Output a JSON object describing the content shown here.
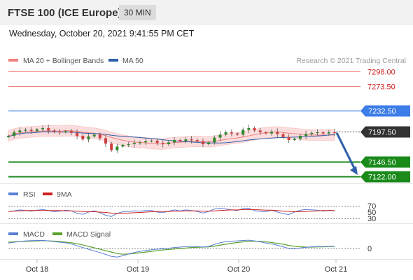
{
  "header": {
    "title": "FTSE 100 (ICE Europe)",
    "interval": "30 MIN"
  },
  "datetime": "Wednesday, October 20, 2021 9:41:55 PM CET",
  "legend": {
    "ma20": "MA 20 + Bollinger Bands",
    "ma50": "MA 50",
    "credit": "Research © 2021 Trading Central"
  },
  "colors": {
    "resistance": "#f08080",
    "pivot": "#3d7de8",
    "support": "#1a8a1a",
    "current": "#333333",
    "ma50": "#2e5fa8",
    "bollinger_fill": "#fbdada",
    "candle_up": "#2a8a2a",
    "candle_down": "#d04040",
    "arrow": "#2e5fa8",
    "rsi": "#5b7fd6",
    "rsi_ma": "#d02020",
    "macd": "#5b7fd6",
    "macd_signal": "#5aa02c"
  },
  "levels": [
    {
      "label": "7298.00",
      "value": 7298.0,
      "kind": "resistance"
    },
    {
      "label": "7273.50",
      "value": 7273.5,
      "kind": "resistance"
    },
    {
      "label": "7232.50",
      "value": 7232.5,
      "kind": "pivot"
    },
    {
      "label": "7197.50",
      "value": 7197.5,
      "kind": "current"
    },
    {
      "label": "7146.50",
      "value": 7146.5,
      "kind": "support"
    },
    {
      "label": "7122.00",
      "value": 7122.0,
      "kind": "support"
    }
  ],
  "rsi_panel": {
    "label": "RSI",
    "ma_label": "9MA",
    "levels": [
      "70",
      "50",
      "30"
    ]
  },
  "macd_panel": {
    "label": "MACD",
    "signal_label": "MACD Signal",
    "zero_label": "0"
  },
  "chart_data": {
    "type": "candlestick",
    "x_ticks": [
      "Oct 18",
      "Oct 19",
      "Oct 20",
      "Oct 21"
    ],
    "ylim": [
      7115,
      7305
    ],
    "close": [
      7190,
      7196,
      7199,
      7200,
      7198,
      7201,
      7203,
      7199,
      7197,
      7196,
      7198,
      7195,
      7190,
      7184,
      7189,
      7192,
      7186,
      7177,
      7166,
      7172,
      7175,
      7176,
      7178,
      7179,
      7181,
      7182,
      7178,
      7176,
      7179,
      7183,
      7181,
      7184,
      7183,
      7181,
      7176,
      7179,
      7187,
      7192,
      7196,
      7194,
      7192,
      7200,
      7203,
      7199,
      7196,
      7194,
      7197,
      7193,
      7188,
      7183,
      7185,
      7190,
      7193,
      7195,
      7196,
      7194,
      7196,
      7195
    ],
    "forecast": {
      "from": 7197.5,
      "to": 7122.0
    }
  },
  "rsi_data": {
    "rsi": [
      52,
      54,
      57,
      55,
      53,
      56,
      58,
      55,
      51,
      53,
      56,
      54,
      46,
      43,
      50,
      54,
      48,
      40,
      36,
      46,
      51,
      52,
      54,
      53,
      55,
      55,
      50,
      48,
      53,
      57,
      54,
      57,
      55,
      52,
      47,
      52,
      60,
      62,
      60,
      57,
      55,
      61,
      62,
      55,
      52,
      51,
      56,
      50,
      45,
      42,
      50,
      56,
      58,
      57,
      56,
      53,
      56,
      54
    ],
    "ma": [
      52,
      53,
      54,
      55,
      55,
      55,
      55,
      55,
      55,
      55,
      54,
      54,
      53,
      52,
      51,
      51,
      50,
      49,
      47,
      46,
      46,
      47,
      48,
      49,
      50,
      51,
      52,
      52,
      52,
      53,
      53,
      54,
      54,
      54,
      53,
      53,
      54,
      55,
      56,
      57,
      57,
      58,
      58,
      58,
      57,
      56,
      56,
      55,
      53,
      52,
      51,
      51,
      52,
      53,
      54,
      55,
      55,
      55
    ]
  },
  "macd_data": {
    "macd": [
      2.0,
      2.3,
      2.6,
      2.9,
      3.0,
      3.1,
      3.1,
      2.9,
      2.6,
      2.3,
      2.1,
      1.6,
      0.9,
      0.1,
      -0.6,
      -1.3,
      -2.0,
      -2.8,
      -3.6,
      -3.9,
      -3.3,
      -2.6,
      -2.0,
      -1.5,
      -1.1,
      -0.8,
      -0.6,
      -0.4,
      -0.2,
      0.1,
      0.3,
      0.5,
      0.6,
      0.5,
      0.3,
      0.6,
      1.4,
      2.1,
      2.6,
      2.8,
      2.9,
      3.1,
      3.2,
      2.9,
      2.5,
      2.0,
      1.6,
      1.1,
      0.4,
      -0.3,
      -0.4,
      -0.1,
      0.2,
      0.4,
      0.5,
      0.5,
      0.6,
      0.6
    ],
    "signal": [
      2.4,
      2.5,
      2.6,
      2.7,
      2.8,
      2.9,
      3.0,
      2.9,
      2.8,
      2.6,
      2.4,
      2.1,
      1.7,
      1.2,
      0.6,
      0.0,
      -0.6,
      -1.2,
      -1.8,
      -2.4,
      -2.7,
      -2.6,
      -2.4,
      -2.1,
      -1.8,
      -1.5,
      -1.2,
      -0.9,
      -0.7,
      -0.5,
      -0.3,
      -0.1,
      0.1,
      0.2,
      0.3,
      0.4,
      0.7,
      1.1,
      1.5,
      1.9,
      2.2,
      2.5,
      2.7,
      2.8,
      2.7,
      2.5,
      2.2,
      1.9,
      1.5,
      1.0,
      0.6,
      0.4,
      0.3,
      0.3,
      0.4,
      0.4,
      0.5,
      0.5
    ]
  }
}
